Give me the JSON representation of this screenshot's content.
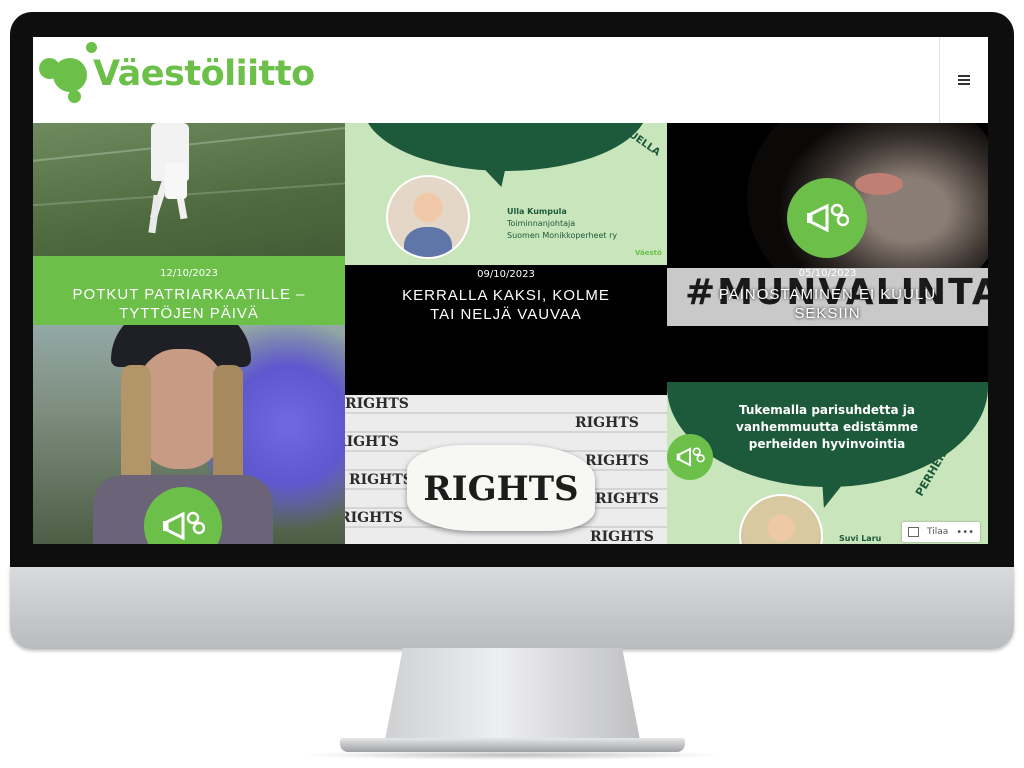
{
  "site": {
    "brand_name": "Väestöliitto",
    "menu_icon": "hamburger-menu-icon",
    "brand_color": "#6cc04a"
  },
  "posts": [
    {
      "date": "12/10/2023",
      "title": "POTKUT PATRIARKAATILLE – TYTTÖJEN PÄIVÄ",
      "image": "football-players-photo"
    },
    {
      "date": "09/10/2023",
      "title": "KERRALLA KAKSI, KOLME TAI NELJÄ VAUVAA",
      "image": "speech-bubble-graphic",
      "card": {
        "name": "Ulla Kumpula",
        "role": "Toiminnanjohtaja",
        "org": "Suomen Monikkoperheet ry",
        "logo_text": "Väestö",
        "arc_text": "PE ... UELLA"
      }
    },
    {
      "date": "05/10/2023",
      "title": "PAINOSTAMINEN EI KUULU SEKSIIN",
      "image": "hooded-face-photo",
      "banner_text": "#MUNVALINTA"
    },
    {
      "image": "smoke-bomb-woman-photo"
    },
    {
      "image": "rights-paper-photo",
      "headline": "RIGHTS",
      "bg_word": "RIGHTS"
    },
    {
      "image": "parenting-graphic",
      "card": {
        "text": "Tukemalla parisuhdetta ja vanhemmuutta edistämme perheiden hyvinvointia",
        "name": "Suvi Laru",
        "arc_text": "PERHEIDEN"
      }
    }
  ],
  "follow_widget": {
    "label": "Tilaa",
    "more": "•••"
  }
}
